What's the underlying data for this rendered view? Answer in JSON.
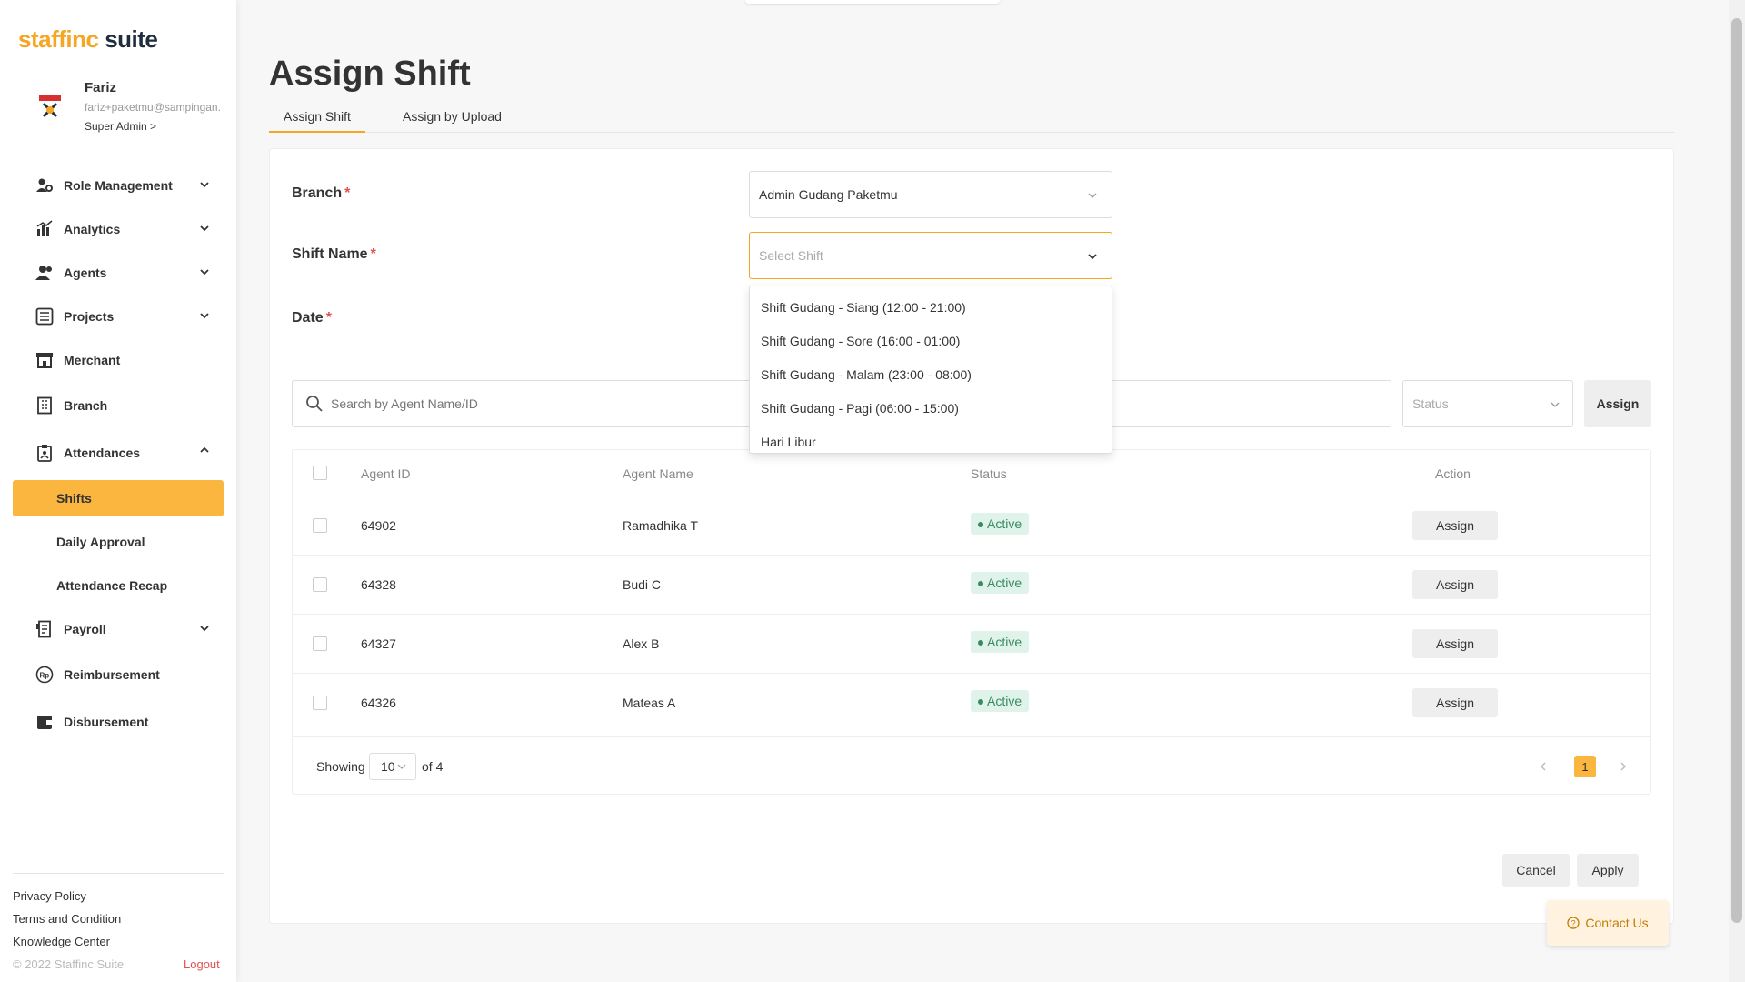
{
  "app": {
    "brand_primary": "staffinc",
    "brand_secondary": "suite",
    "accent_color": "#f5a623"
  },
  "user": {
    "name": "Fariz",
    "email": "fariz+paketmu@sampingan.",
    "role": "Super Admin >"
  },
  "sidebar": {
    "items": [
      {
        "label": "Role Management",
        "icon": "user-gear-icon",
        "expandable": true
      },
      {
        "label": "Analytics",
        "icon": "bar-chart-icon",
        "expandable": true
      },
      {
        "label": "Agents",
        "icon": "users-icon",
        "expandable": true
      },
      {
        "label": "Projects",
        "icon": "list-icon",
        "expandable": true
      },
      {
        "label": "Merchant",
        "icon": "store-icon",
        "expandable": false
      },
      {
        "label": "Branch",
        "icon": "building-icon",
        "expandable": false
      },
      {
        "label": "Attendances",
        "icon": "clipboard-icon",
        "expandable": true,
        "expanded": true
      }
    ],
    "attendance_sub": [
      {
        "label": "Shifts",
        "active": true
      },
      {
        "label": "Daily Approval"
      },
      {
        "label": "Attendance Recap"
      }
    ],
    "items_after": [
      {
        "label": "Payroll",
        "icon": "receipt-icon",
        "expandable": true
      },
      {
        "label": "Reimbursement",
        "icon": "rupiah-icon",
        "expandable": false
      },
      {
        "label": "Disbursement",
        "icon": "wallet-icon",
        "expandable": false
      }
    ],
    "footer": {
      "privacy": "Privacy Policy",
      "terms": "Terms and Condition",
      "knowledge": "Knowledge Center",
      "copyright": "© 2022 Staffinc Suite",
      "logout": "Logout"
    }
  },
  "page": {
    "title": "Assign Shift",
    "tabs": [
      {
        "label": "Assign Shift",
        "active": true
      },
      {
        "label": "Assign by Upload"
      }
    ]
  },
  "form": {
    "branch_label": "Branch",
    "branch_value": "Admin Gudang Paketmu",
    "shift_label": "Shift Name",
    "shift_placeholder": "Select Shift",
    "date_label": "Date",
    "required_mark": "*",
    "shift_options": [
      "Shift Gudang - Siang (12:00 - 21:00)",
      "Shift Gudang - Sore (16:00 - 01:00)",
      "Shift Gudang - Malam (23:00 - 08:00)",
      "Shift Gudang - Pagi (06:00 - 15:00)",
      "Hari Libur"
    ]
  },
  "filter": {
    "search_placeholder": "Search by Agent Name/ID",
    "status_placeholder": "Status",
    "assign_label": "Assign"
  },
  "table": {
    "headers": {
      "agent_id": "Agent ID",
      "agent_name": "Agent Name",
      "status": "Status",
      "action": "Action"
    },
    "rows": [
      {
        "agent_id": "64902",
        "agent_name": "Ramadhika T",
        "status": "Active",
        "action": "Assign"
      },
      {
        "agent_id": "64328",
        "agent_name": "Budi C",
        "status": "Active",
        "action": "Assign"
      },
      {
        "agent_id": "64327",
        "agent_name": "Alex B",
        "status": "Active",
        "action": "Assign"
      },
      {
        "agent_id": "64326",
        "agent_name": "Mateas A",
        "status": "Active",
        "action": "Assign"
      }
    ],
    "footer": {
      "showing": "Showing",
      "page_size": "10",
      "of_total": "of 4",
      "current_page": "1"
    }
  },
  "actions": {
    "cancel": "Cancel",
    "apply": "Apply"
  },
  "contact": {
    "label": "Contact Us"
  }
}
